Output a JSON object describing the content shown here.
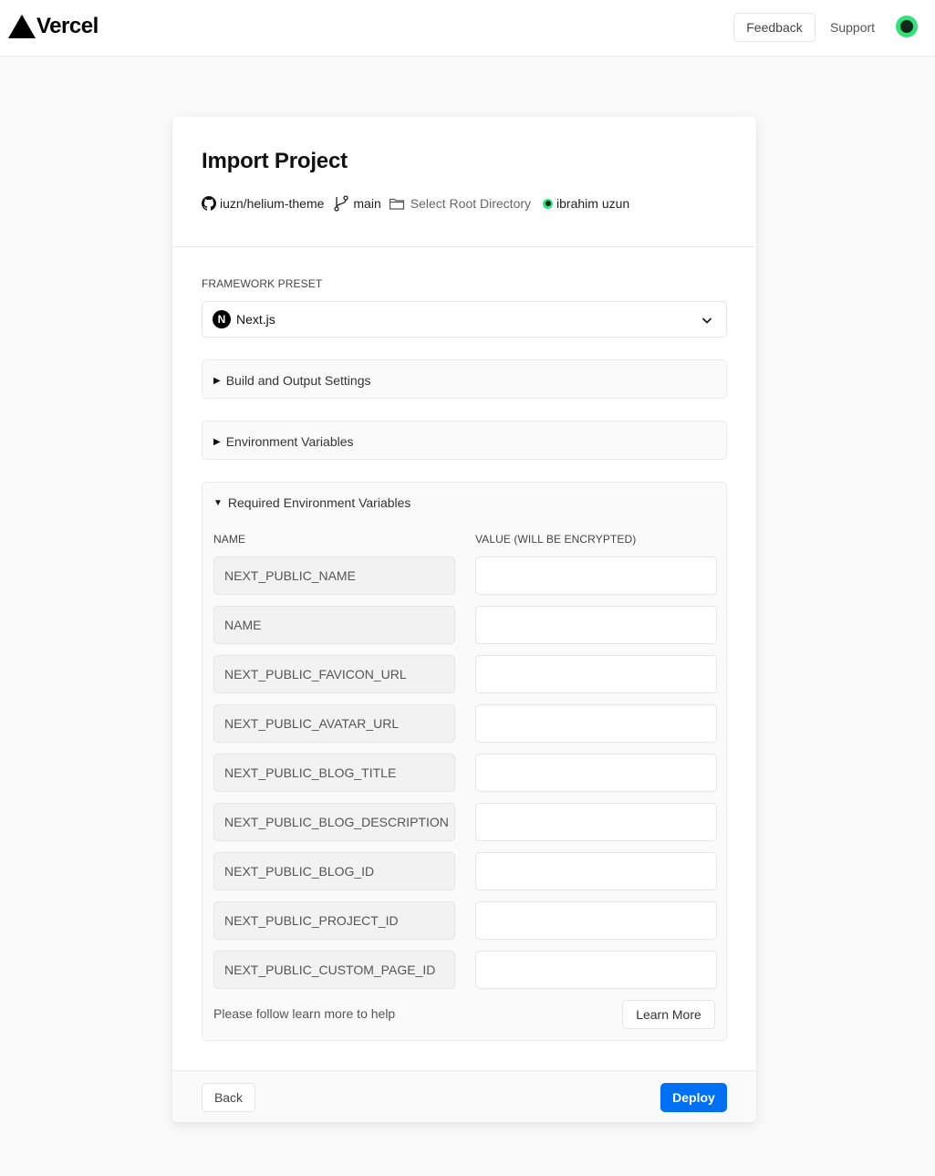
{
  "header": {
    "brand": "Vercel",
    "feedback_label": "Feedback",
    "support_label": "Support"
  },
  "project": {
    "title": "Import Project",
    "repo": "iuzn/helium-theme",
    "branch": "main",
    "root_directory": "Select Root Directory",
    "owner": "ibrahim uzun"
  },
  "framework": {
    "label": "FRAMEWORK PRESET",
    "selected": "Next.js"
  },
  "sections": {
    "build_settings": "Build and Output Settings",
    "env_vars": "Environment Variables",
    "required_env": "Required Environment Variables"
  },
  "required_env": {
    "name_header": "NAME",
    "value_header": "VALUE (WILL BE ENCRYPTED)",
    "variables": [
      {
        "name": "NEXT_PUBLIC_NAME",
        "value": ""
      },
      {
        "name": "NAME",
        "value": ""
      },
      {
        "name": "NEXT_PUBLIC_FAVICON_URL",
        "value": ""
      },
      {
        "name": "NEXT_PUBLIC_AVATAR_URL",
        "value": ""
      },
      {
        "name": "NEXT_PUBLIC_BLOG_TITLE",
        "value": ""
      },
      {
        "name": "NEXT_PUBLIC_BLOG_DESCRIPTION",
        "value": ""
      },
      {
        "name": "NEXT_PUBLIC_BLOG_ID",
        "value": ""
      },
      {
        "name": "NEXT_PUBLIC_PROJECT_ID",
        "value": ""
      },
      {
        "name": "NEXT_PUBLIC_CUSTOM_PAGE_ID",
        "value": ""
      }
    ],
    "help_text": "Please follow learn more to help",
    "learn_more_label": "Learn More"
  },
  "footer": {
    "back_label": "Back",
    "deploy_label": "Deploy"
  },
  "colors": {
    "accent": "#0070f3",
    "avatar_green": "#34e07a"
  }
}
